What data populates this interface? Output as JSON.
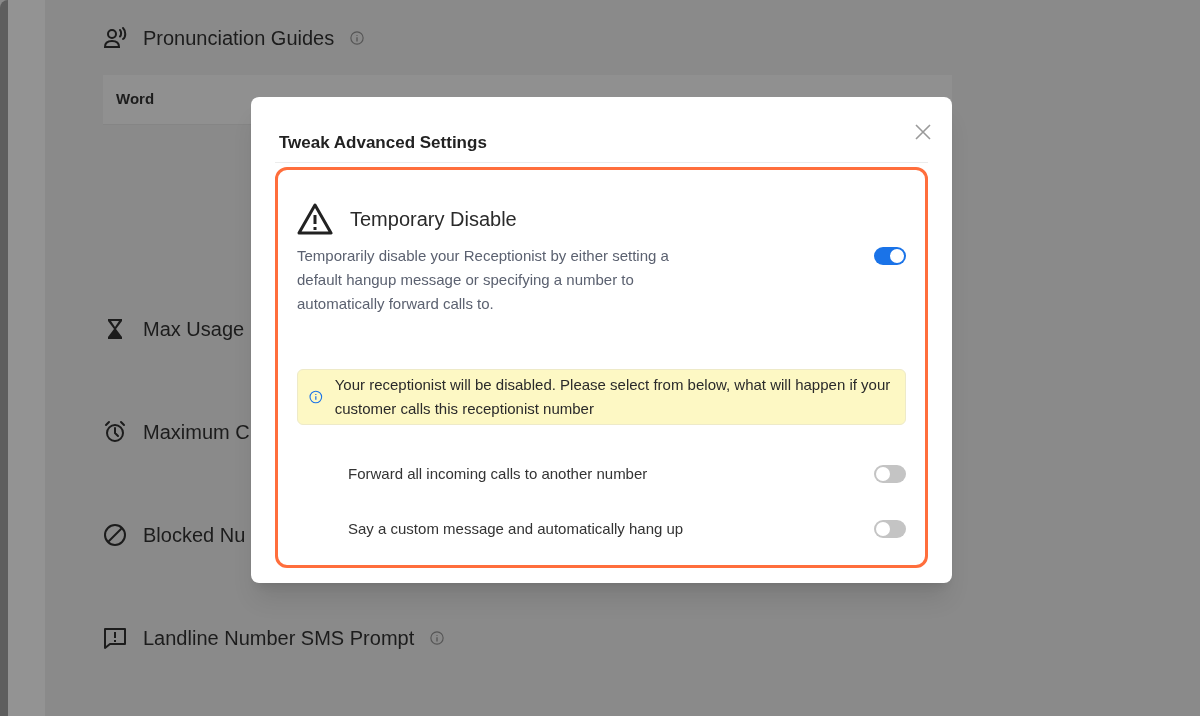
{
  "page": {
    "sections": [
      {
        "title": "Pronunciation Guides",
        "info": true,
        "table_header": "Word"
      },
      {
        "title": "Max Usage",
        "info": false
      },
      {
        "title": "Maximum C",
        "info": false
      },
      {
        "title": "Blocked Nu",
        "info": false
      },
      {
        "title": "Landline Number SMS Prompt",
        "info": true
      }
    ]
  },
  "modal": {
    "title": "Tweak Advanced Settings",
    "setting": {
      "title": "Temporary Disable",
      "description": "Temporarily disable your Receptionist by either setting a default hangup message or specifying a number to automatically forward calls to.",
      "on": true
    },
    "notice": "Your receptionist will be disabled. Please select from below, what will happen if your customer calls this receptionist number",
    "options": [
      {
        "label": "Forward all incoming calls to another number",
        "on": false
      },
      {
        "label": "Say a custom message and automatically hang up",
        "on": false
      }
    ]
  }
}
